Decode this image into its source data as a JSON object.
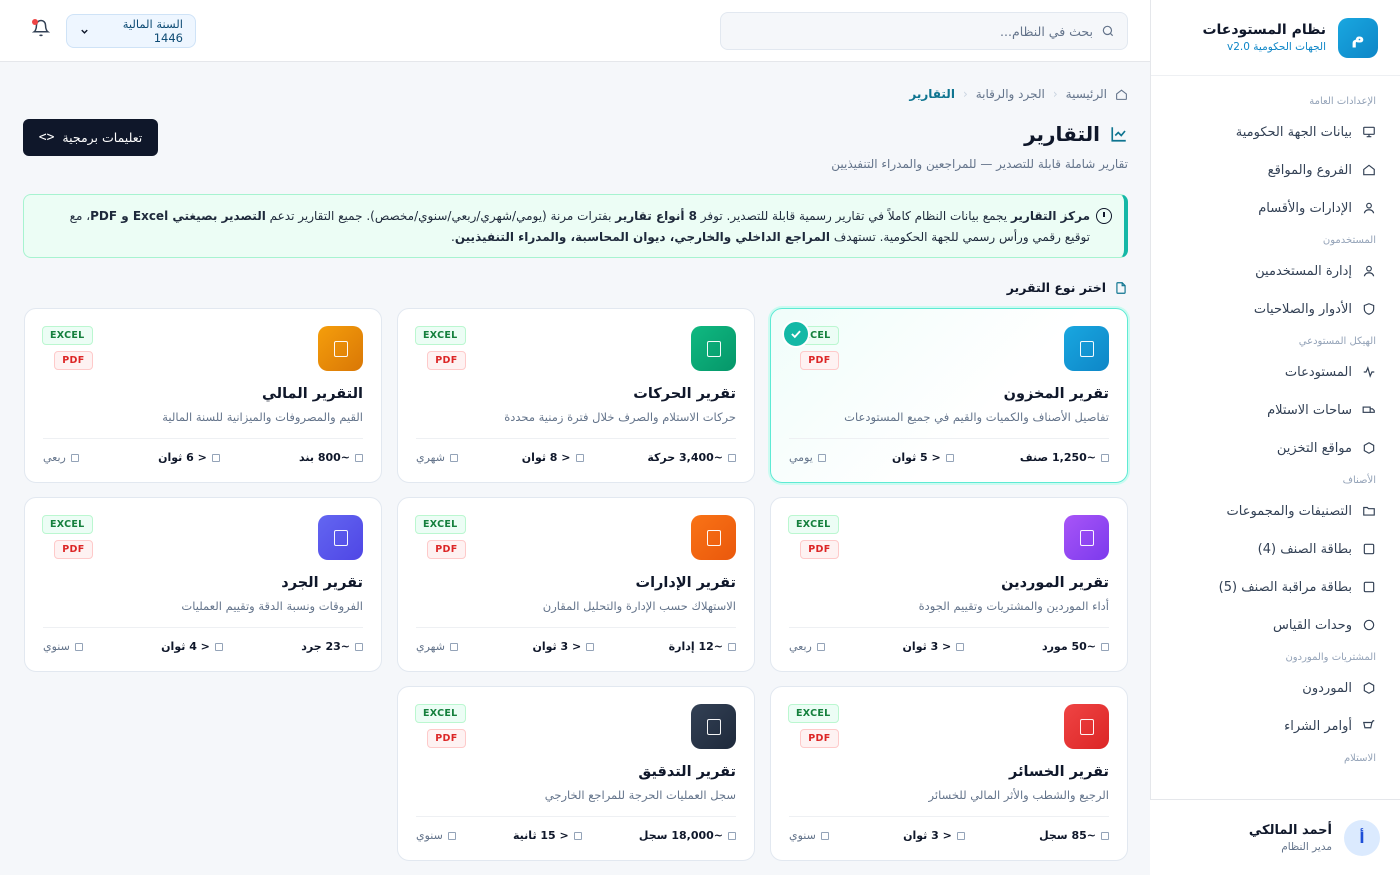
{
  "sidebar": {
    "brand_letter": "م",
    "brand_title": "نظام المستودعات",
    "brand_sub": "الجهات الحكومية v2.0",
    "groups": [
      {
        "label": "الإعدادات العامة",
        "items": [
          {
            "label": "بيانات الجهة الحكومية",
            "icon": "monitor-icon"
          },
          {
            "label": "الفروع والمواقع",
            "icon": "home-icon"
          },
          {
            "label": "الإدارات والأقسام",
            "icon": "user-icon"
          }
        ]
      },
      {
        "label": "المستخدمون",
        "items": [
          {
            "label": "إدارة المستخدمين",
            "icon": "user-icon"
          },
          {
            "label": "الأدوار والصلاحيات",
            "icon": "shield-icon"
          }
        ]
      },
      {
        "label": "الهيكل المستودعي",
        "items": [
          {
            "label": "المستودعات",
            "icon": "activity-icon"
          },
          {
            "label": "ساحات الاستلام",
            "icon": "truck-icon"
          },
          {
            "label": "مواقع التخزين",
            "icon": "hexagon-icon"
          }
        ]
      },
      {
        "label": "الأصناف",
        "items": [
          {
            "label": "التصنيفات والمجموعات",
            "icon": "folder-icon"
          },
          {
            "label": "بطاقة الصنف (4)",
            "icon": "square-icon"
          },
          {
            "label": "بطاقة مراقبة الصنف (5)",
            "icon": "square-icon"
          },
          {
            "label": "وحدات القياس",
            "icon": "circle-icon"
          }
        ]
      },
      {
        "label": "المشتريات والموردون",
        "items": [
          {
            "label": "الموردون",
            "icon": "hexagon-icon"
          },
          {
            "label": "أوامر الشراء",
            "icon": "cart-icon"
          }
        ]
      },
      {
        "label": "الاستلام",
        "items": []
      }
    ],
    "user": {
      "initial": "أ",
      "name": "أحمد المالكي",
      "role": "مدير النظام"
    }
  },
  "topbar": {
    "search_placeholder": "بحث في النظام...",
    "fiscal_year": "السنة المالية 1446"
  },
  "breadcrumb": [
    "الرئيسية",
    "الجرد والرقابة",
    "التقارير"
  ],
  "page": {
    "title": "التقارير",
    "subtitle": "تقارير شاملة قابلة للتصدير — للمراجعين والمدراء التنفيذيين",
    "api_button": "تعليمات برمجية"
  },
  "info": {
    "b1": "مركز التقارير",
    "t1": " يجمع بيانات النظام كاملاً في تقارير رسمية قابلة للتصدير. توفر ",
    "b2": "8 أنواع تقارير",
    "t2": " بفترات مرنة (يومي/شهري/ربعي/سنوي/مخصص). جميع التقارير تدعم ",
    "b3": "التصدير بصيغتي Excel و PDF",
    "t3": "، مع توقيع رقمي ورأس رسمي للجهة الحكومية. تستهدف ",
    "b4": "المراجع الداخلي والخارجي، ديوان المحاسبة، والمدراء التنفيذيين",
    "t4": "."
  },
  "section_label": "اختر نوع التقرير",
  "badges": {
    "excel": "EXCEL",
    "pdf": "PDF"
  },
  "colors": {
    "accent": "#14b8a6",
    "dark": "#0f172a"
  },
  "reports": [
    {
      "title": "تقرير المخزون",
      "desc": "تفاصيل الأصناف والكميات والقيم في جميع المستودعات",
      "count": "~1,250 صنف",
      "time": "< 5 ثوان",
      "period": "يومي",
      "color": "#0e86c7",
      "color2": "#19a7e0",
      "selected": true
    },
    {
      "title": "تقرير الحركات",
      "desc": "حركات الاستلام والصرف خلال فترة زمنية محددة",
      "count": "~3,400 حركة",
      "time": "< 8 ثوان",
      "period": "شهري",
      "color": "#059669",
      "color2": "#10b981",
      "selected": false
    },
    {
      "title": "التقرير المالي",
      "desc": "القيم والمصروفات والميزانية للسنة المالية",
      "count": "~800 بند",
      "time": "< 6 ثوان",
      "period": "ربعي",
      "color": "#d97706",
      "color2": "#f59e0b",
      "selected": false
    },
    {
      "title": "تقرير الموردين",
      "desc": "أداء الموردين والمشتريات وتقييم الجودة",
      "count": "~50 مورد",
      "time": "< 3 ثوان",
      "period": "ربعي",
      "color": "#7c3aed",
      "color2": "#a855f7",
      "selected": false
    },
    {
      "title": "تقرير الإدارات",
      "desc": "الاستهلاك حسب الإدارة والتحليل المقارن",
      "count": "~12 إدارة",
      "time": "< 3 ثوان",
      "period": "شهري",
      "color": "#ea580c",
      "color2": "#f97316",
      "selected": false
    },
    {
      "title": "تقرير الجرد",
      "desc": "الفروقات ونسبة الدقة وتقييم العمليات",
      "count": "~23 جرد",
      "time": "< 4 ثوان",
      "period": "سنوي",
      "color": "#4f46e5",
      "color2": "#6366f1",
      "selected": false
    },
    {
      "title": "تقرير الخسائر",
      "desc": "الرجيع والشطب والأثر المالي للخسائر",
      "count": "~85 سجل",
      "time": "< 3 ثوان",
      "period": "سنوي",
      "color": "#dc2626",
      "color2": "#ef4444",
      "selected": false
    },
    {
      "title": "تقرير التدقيق",
      "desc": "سجل العمليات الحرجة للمراجع الخارجي",
      "count": "~18,000 سجل",
      "time": "< 15 ثانية",
      "period": "سنوي",
      "color": "#1e293b",
      "color2": "#334155",
      "selected": false
    }
  ]
}
